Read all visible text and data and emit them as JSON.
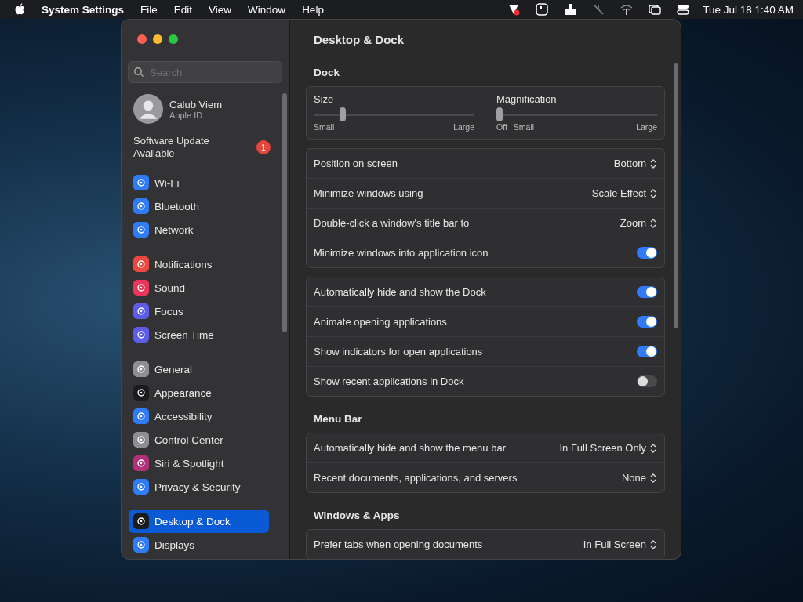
{
  "menu_bar": {
    "app": "System Settings",
    "menus": [
      "File",
      "Edit",
      "View",
      "Window",
      "Help"
    ],
    "clock": "Tue Jul 18  1:40 AM"
  },
  "sidebar": {
    "search": {
      "placeholder": "Search"
    },
    "account": {
      "name": "Calub Viem",
      "subtitle": "Apple ID"
    },
    "update": {
      "label": "Software Update Available",
      "badge": "1"
    },
    "groups": [
      [
        {
          "label": "Wi-Fi",
          "color": "#2f7cf6",
          "selected": false
        },
        {
          "label": "Bluetooth",
          "color": "#2f7cf6",
          "selected": false
        },
        {
          "label": "Network",
          "color": "#2f7cf6",
          "selected": false
        }
      ],
      [
        {
          "label": "Notifications",
          "color": "#e9493f",
          "selected": false
        },
        {
          "label": "Sound",
          "color": "#e8375a",
          "selected": false
        },
        {
          "label": "Focus",
          "color": "#5e5ce6",
          "selected": false
        },
        {
          "label": "Screen Time",
          "color": "#5e5ce6",
          "selected": false
        }
      ],
      [
        {
          "label": "General",
          "color": "#8e8e93",
          "selected": false
        },
        {
          "label": "Appearance",
          "color": "#1c1c1e",
          "selected": false
        },
        {
          "label": "Accessibility",
          "color": "#2f7cf6",
          "selected": false
        },
        {
          "label": "Control Center",
          "color": "#8e8e93",
          "selected": false
        },
        {
          "label": "Siri & Spotlight",
          "color": "#b0307a",
          "selected": false
        },
        {
          "label": "Privacy & Security",
          "color": "#2f7cf6",
          "selected": false
        }
      ],
      [
        {
          "label": "Desktop & Dock",
          "color": "#1c1c1e",
          "selected": true
        },
        {
          "label": "Displays",
          "color": "#2f7cf6",
          "selected": false
        }
      ]
    ]
  },
  "content": {
    "title": "Desktop & Dock",
    "sections": [
      {
        "title": "Dock",
        "sliders": [
          {
            "label": "Size",
            "level": 0.17,
            "min": "Small",
            "max": "Large"
          },
          {
            "label": "Magnification",
            "level": 0,
            "off": "Off",
            "min": "Small",
            "max": "Large"
          }
        ],
        "groups": [
          [
            {
              "kind": "select",
              "label": "Position on screen",
              "value": "Bottom"
            },
            {
              "kind": "select",
              "label": "Minimize windows using",
              "value": "Scale Effect"
            },
            {
              "kind": "select",
              "label": "Double-click a window's title bar to",
              "value": "Zoom"
            },
            {
              "kind": "toggle",
              "label": "Minimize windows into application icon",
              "on": true
            }
          ],
          [
            {
              "kind": "toggle",
              "label": "Automatically hide and show the Dock",
              "on": true
            },
            {
              "kind": "toggle",
              "label": "Animate opening applications",
              "on": true
            },
            {
              "kind": "toggle",
              "label": "Show indicators for open applications",
              "on": true
            },
            {
              "kind": "toggle",
              "label": "Show recent applications in Dock",
              "on": false
            }
          ]
        ]
      },
      {
        "title": "Menu Bar",
        "groups": [
          [
            {
              "kind": "select",
              "label": "Automatically hide and show the menu bar",
              "value": "In Full Screen Only"
            },
            {
              "kind": "select",
              "label": "Recent documents, applications, and servers",
              "value": "None"
            }
          ]
        ]
      },
      {
        "title": "Windows & Apps",
        "groups": [
          [
            {
              "kind": "select",
              "label": "Prefer tabs when opening documents",
              "value": "In Full Screen"
            }
          ]
        ]
      }
    ]
  }
}
